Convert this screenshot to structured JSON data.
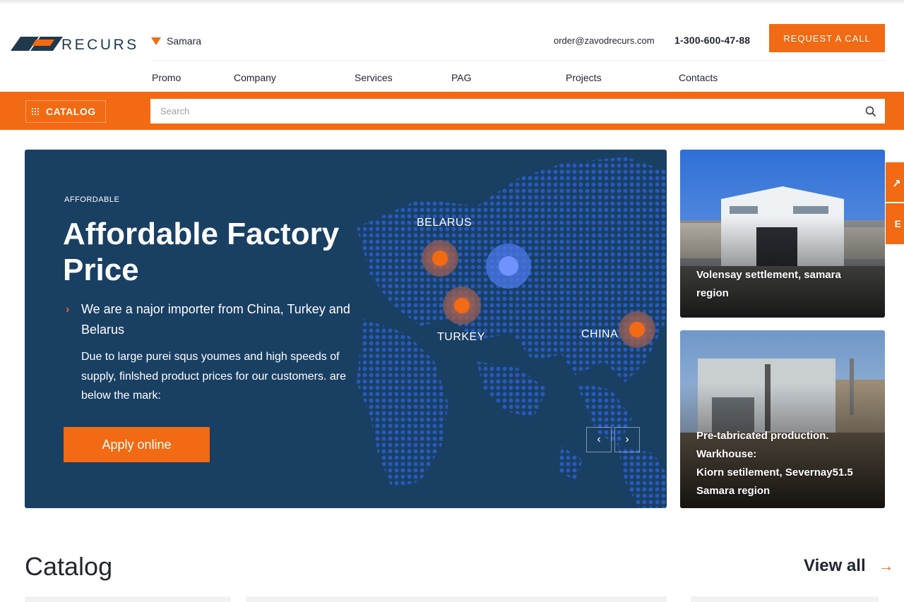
{
  "header": {
    "logo_text": "RECURS",
    "city": "Samara",
    "email": "order@zavodrecurs.com",
    "phone": "1-300-600-47-88",
    "request_call_label": "REQUEST A CALL"
  },
  "nav": {
    "items": [
      "Promo",
      "Company",
      "Services",
      "PAG",
      "Projects",
      "Contacts"
    ]
  },
  "toolbar": {
    "catalog_label": "CATALOG",
    "search_placeholder": "Search"
  },
  "hero": {
    "kicker": "AFFORDABLE",
    "title": "Affordable Factory Price",
    "bullet": "We are a najor importer from China, Turkey and Belarus",
    "description": "Due to large purei squs youmes and high speeds of supply, finlshed product prices for our customers. are below the mark:",
    "apply_label": "Apply online",
    "prev_icon": "chevron-left-icon",
    "next_icon": "chevron-right-icon",
    "countries": [
      "BELARUS",
      "TURKEY",
      "CHINA"
    ]
  },
  "cards": [
    {
      "caption_lines": [
        "Volensay settlement, samara",
        "region"
      ]
    },
    {
      "caption_lines": [
        "Pre-tabricated production.",
        "Warkhouse:",
        "Kiorn setilement, Severnay51.5",
        "Samara region"
      ]
    }
  ],
  "side_tabs": [
    "",
    "E"
  ],
  "catalog": {
    "heading": "Catalog",
    "view_all_label": "View all",
    "view_all_arrow": "→"
  },
  "colors": {
    "accent": "#f26a13",
    "hero_bg": "#193f63",
    "brand_dark": "#20394f"
  }
}
